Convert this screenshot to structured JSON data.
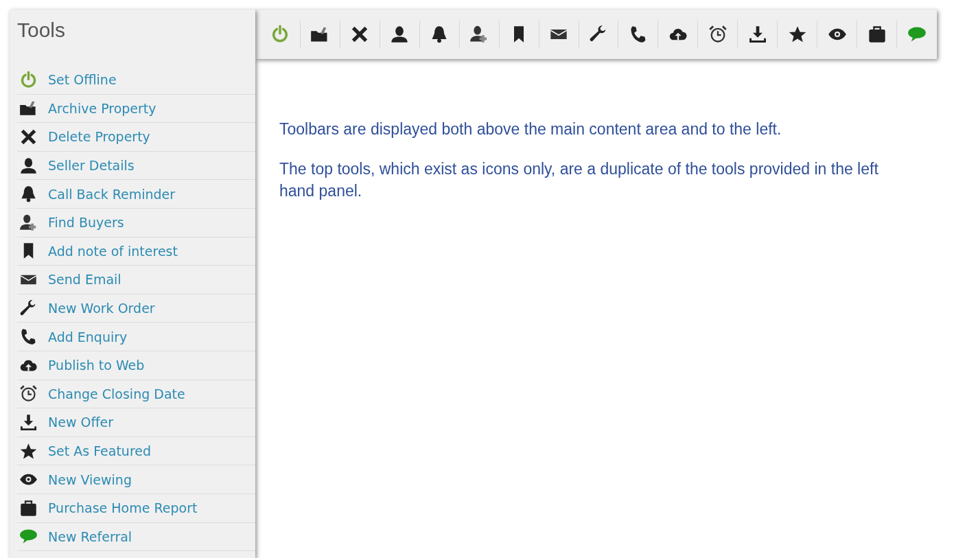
{
  "sidebar": {
    "title": "Tools",
    "items": [
      {
        "label": "Set Offline",
        "kind": "power"
      },
      {
        "label": "Archive Property",
        "kind": "folder"
      },
      {
        "label": "Delete Property",
        "kind": "cross"
      },
      {
        "label": "Seller Details",
        "kind": "person"
      },
      {
        "label": "Call Back Reminder",
        "kind": "bell"
      },
      {
        "label": "Find Buyers",
        "kind": "personplus"
      },
      {
        "label": "Add note of interest",
        "kind": "bookmark"
      },
      {
        "label": "Send Email",
        "kind": "envelope"
      },
      {
        "label": "New Work Order",
        "kind": "wrench"
      },
      {
        "label": "Add Enquiry",
        "kind": "phone"
      },
      {
        "label": "Publish to Web",
        "kind": "cloud"
      },
      {
        "label": "Change Closing Date",
        "kind": "alarm"
      },
      {
        "label": "New Offer",
        "kind": "download"
      },
      {
        "label": "Set As Featured",
        "kind": "star"
      },
      {
        "label": "New Viewing",
        "kind": "eye"
      },
      {
        "label": "Purchase Home Report",
        "kind": "briefcase"
      },
      {
        "label": "New Referral",
        "kind": "bubble"
      }
    ]
  },
  "toolbar": {
    "items": [
      {
        "kind": "power"
      },
      {
        "kind": "folder"
      },
      {
        "kind": "cross"
      },
      {
        "kind": "person"
      },
      {
        "kind": "bell"
      },
      {
        "kind": "personplus"
      },
      {
        "kind": "bookmark"
      },
      {
        "kind": "envelope"
      },
      {
        "kind": "wrench"
      },
      {
        "kind": "phone"
      },
      {
        "kind": "cloud"
      },
      {
        "kind": "alarm"
      },
      {
        "kind": "download"
      },
      {
        "kind": "star"
      },
      {
        "kind": "eye"
      },
      {
        "kind": "briefcase"
      },
      {
        "kind": "bubble"
      }
    ]
  },
  "content": {
    "paragraphs": [
      "Toolbars are displayed both above the main content area and to the left.",
      "The top tools, which exist as icons only, are a duplicate of the tools provided in the left hand panel."
    ]
  }
}
